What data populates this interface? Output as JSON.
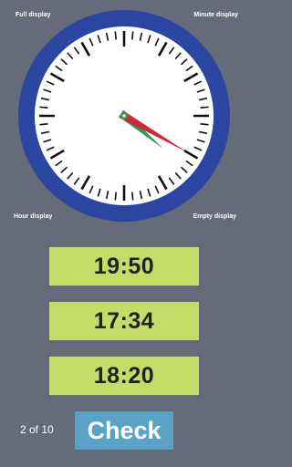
{
  "modes": {
    "full": "Full display",
    "minute": "Minute display",
    "hour": "Hour display",
    "empty": "Empty display"
  },
  "clock": {
    "hour": 4,
    "minute": 20,
    "colors": {
      "ring": "#2a46a0",
      "face": "#ffffff",
      "ticks": "#111111",
      "hour_hand": "#2f9a4c",
      "minute_hand": "#cc2a3a",
      "hub": "#2f9a4c"
    }
  },
  "answers": [
    "19:50",
    "17:34",
    "18:20"
  ],
  "progress": "2 of 10",
  "check_label": "Check",
  "colors": {
    "background": "#656b78",
    "answer_bg": "#c6dc6a",
    "check_bg": "#5aa2c6"
  }
}
